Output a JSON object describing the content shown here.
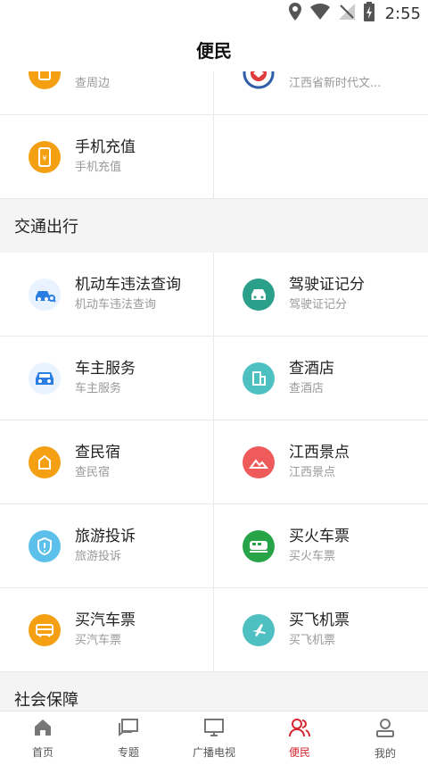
{
  "status_bar": {
    "time": "2:55"
  },
  "header": {
    "title": "便民"
  },
  "top_grid": [
    {
      "title": "查周边",
      "subtitle": "查周边",
      "icon": "location-bag-icon",
      "color": "#f4a012"
    },
    {
      "title": "江西省新时代文...",
      "subtitle": "江西省新时代文...",
      "icon": "emblem-icon",
      "color": "#e8eef7"
    },
    {
      "title": "手机充值",
      "subtitle": "手机充值",
      "icon": "phone-recharge-icon",
      "color": "#f4a012"
    },
    {
      "title": "",
      "subtitle": "",
      "icon": "",
      "color": ""
    }
  ],
  "sections": [
    {
      "title": "交通出行",
      "items": [
        {
          "title": "机动车违法查询",
          "subtitle": "机动车违法查询",
          "icon": "car-search-icon",
          "color": "#e9f2ff"
        },
        {
          "title": "驾驶证记分",
          "subtitle": "驾驶证记分",
          "icon": "car-icon",
          "color": "#2aa08a"
        },
        {
          "title": "车主服务",
          "subtitle": "车主服务",
          "icon": "car-front-icon",
          "color": "#e9f2ff"
        },
        {
          "title": "查酒店",
          "subtitle": "查酒店",
          "icon": "hotel-icon",
          "color": "#4ec0c1"
        },
        {
          "title": "查民宿",
          "subtitle": "查民宿",
          "icon": "homestay-icon",
          "color": "#f4a012"
        },
        {
          "title": "江西景点",
          "subtitle": "江西景点",
          "icon": "mountain-icon",
          "color": "#ef5b5b"
        },
        {
          "title": "旅游投诉",
          "subtitle": "旅游投诉",
          "icon": "shield-alert-icon",
          "color": "#5cc0ea"
        },
        {
          "title": "买火车票",
          "subtitle": "买火车票",
          "icon": "train-icon",
          "color": "#27a447"
        },
        {
          "title": "买汽车票",
          "subtitle": "买汽车票",
          "icon": "bus-icon",
          "color": "#f4a012"
        },
        {
          "title": "买飞机票",
          "subtitle": "买飞机票",
          "icon": "plane-icon",
          "color": "#4ec0c1"
        }
      ]
    },
    {
      "title": "社会保障",
      "items": []
    }
  ],
  "tabbar": [
    {
      "label": "首页",
      "icon": "home-icon",
      "active": false
    },
    {
      "label": "专题",
      "icon": "chat-icon",
      "active": false
    },
    {
      "label": "广播电视",
      "icon": "tv-icon",
      "active": false
    },
    {
      "label": "便民",
      "icon": "people-icon",
      "active": true
    },
    {
      "label": "我的",
      "icon": "user-icon",
      "active": false
    }
  ],
  "colors": {
    "accent": "#d8262f",
    "muted": "#999999"
  }
}
